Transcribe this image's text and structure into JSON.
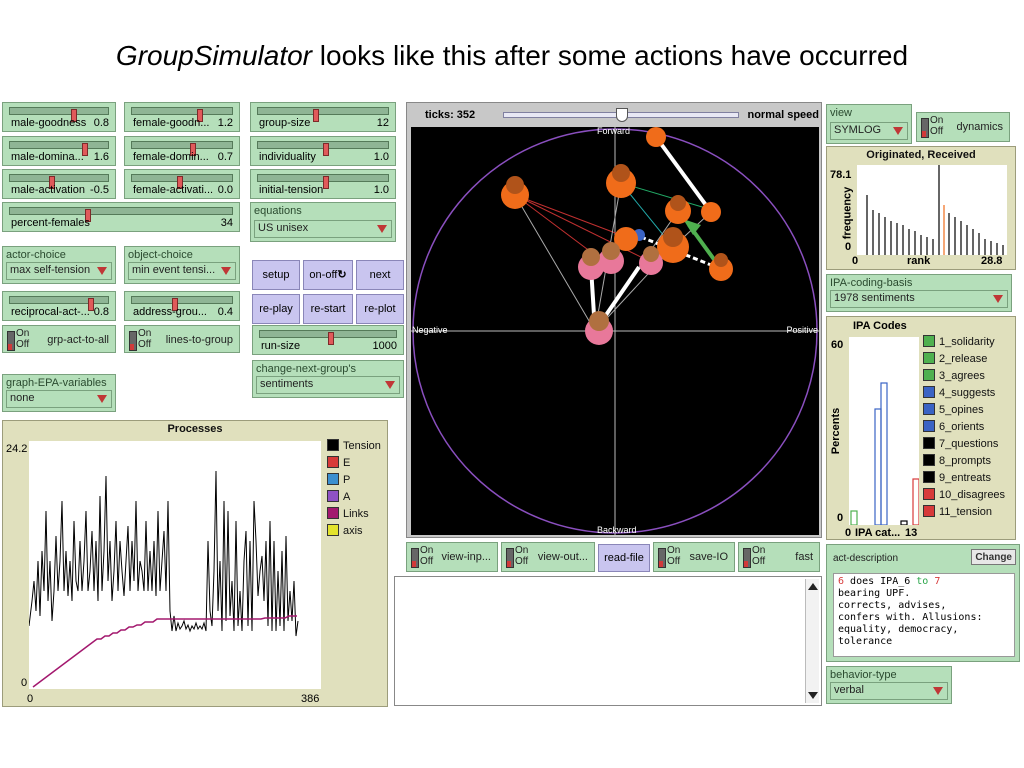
{
  "slide": {
    "title_italic": "GroupSimulator",
    "title_rest": " looks like this after some actions have occurred"
  },
  "sliders": {
    "male_goodness": {
      "label": "male-goodness",
      "value": "0.8",
      "level": 0.62
    },
    "female_goodness": {
      "label": "female-goodn...",
      "value": "1.2",
      "level": 0.65
    },
    "group_size": {
      "label": "group-size",
      "value": "12",
      "level": 0.42
    },
    "male_dominance": {
      "label": "male-domina...",
      "value": "1.6",
      "level": 0.73
    },
    "female_dominance": {
      "label": "female-domin...",
      "value": "0.7",
      "level": 0.58
    },
    "individuality": {
      "label": "individuality",
      "value": "1.0",
      "level": 0.5
    },
    "male_activation": {
      "label": "male-activation",
      "value": "-0.5",
      "level": 0.4
    },
    "female_activation": {
      "label": "female-activati...",
      "value": "0.0",
      "level": 0.45
    },
    "initial_tension": {
      "label": "initial-tension",
      "value": "1.0",
      "level": 0.5
    },
    "percent_females": {
      "label": "percent-females",
      "value": "34",
      "level": 0.34
    },
    "reciprocal_act": {
      "label": "reciprocal-act-...",
      "value": "0.8",
      "level": 0.8
    },
    "address_group": {
      "label": "address-grou...",
      "value": "0.4",
      "level": 0.4
    },
    "run_size": {
      "label": "run-size",
      "value": "1000",
      "level": 0.5
    }
  },
  "choosers": {
    "equations": {
      "label": "equations",
      "value": "US unisex"
    },
    "actor_choice": {
      "label": "actor-choice",
      "value": "max self-tension"
    },
    "object_choice": {
      "label": "object-choice",
      "value": "min event tensi..."
    },
    "change_next_group": {
      "label": "change-next-group's",
      "value": "sentiments"
    },
    "graph_epa": {
      "label": "graph-EPA-variables",
      "value": "none"
    },
    "view": {
      "label": "view",
      "value": "SYMLOG"
    },
    "ipa_coding_basis": {
      "label": "IPA-coding-basis",
      "value": "1978 sentiments"
    },
    "behavior_type": {
      "label": "behavior-type",
      "value": "verbal"
    }
  },
  "switches": {
    "on": "On",
    "off": "Off",
    "grp_act_to_all": "grp-act-to-all",
    "lines_to_group": "lines-to-group",
    "dynamics": "dynamics",
    "view_inputs": "view-inp...",
    "view_outputs": "view-out...",
    "save_io": "save-IO",
    "fast": "fast"
  },
  "buttons": {
    "setup": "setup",
    "on_off": "on-off",
    "next": "next",
    "re_play": "re-play",
    "re_start": "re-start",
    "re_plot": "re-plot",
    "read_file": "read-file",
    "change": "Change"
  },
  "world": {
    "ticks_label": "ticks: 352",
    "speed_label": "normal speed",
    "axis_top": "Forward",
    "axis_bottom": "Backward",
    "axis_left": "Negative",
    "axis_right": "Positive"
  },
  "processes_plot": {
    "title": "Processes",
    "ymax": "24.2",
    "ymin": "0",
    "xmin": "0",
    "xmax": "386",
    "legend": [
      {
        "name": "Tension",
        "color": "#000000"
      },
      {
        "name": "E",
        "color": "#d73a3a"
      },
      {
        "name": "P",
        "color": "#3b8fd0"
      },
      {
        "name": "A",
        "color": "#8e52c4"
      },
      {
        "name": "Links",
        "color": "#a3186e"
      },
      {
        "name": "axis",
        "color": "#e3e32c"
      }
    ]
  },
  "originated_plot": {
    "title": "Originated, Received",
    "ymax": "78.1",
    "ymin": "0",
    "xmin": "0",
    "xlabel": "rank",
    "xmax": "28.8",
    "ylabel": "frequency"
  },
  "ipa_plot": {
    "title": "IPA Codes",
    "ymax": "60",
    "ymin": "0",
    "xmin": "0",
    "xlabel": "IPA cat...",
    "xmax": "13",
    "ylabel": "Percents",
    "legend": [
      {
        "name": "1_solidarity",
        "color": "#4fb04f"
      },
      {
        "name": "2_release",
        "color": "#4fb04f"
      },
      {
        "name": "3_agrees",
        "color": "#4fb04f"
      },
      {
        "name": "4_suggests",
        "color": "#3a63c4"
      },
      {
        "name": "5_opines",
        "color": "#3a63c4"
      },
      {
        "name": "6_orients",
        "color": "#3a63c4"
      },
      {
        "name": "7_questions",
        "color": "#000000"
      },
      {
        "name": "8_prompts",
        "color": "#000000"
      },
      {
        "name": "9_entreats",
        "color": "#000000"
      },
      {
        "name": "10_disagrees",
        "color": "#d73a3a"
      },
      {
        "name": "11_tension",
        "color": "#d73a3a"
      }
    ]
  },
  "act_description": {
    "label": "act-description",
    "actor": "6",
    "mid": " does IPA_6 ",
    "to": "to",
    "object": " 7",
    "lines": [
      "bearing UPF.",
      "corrects, advises,",
      "confers with. Allusions:",
      "equality, democracy,",
      "tolerance"
    ]
  }
}
